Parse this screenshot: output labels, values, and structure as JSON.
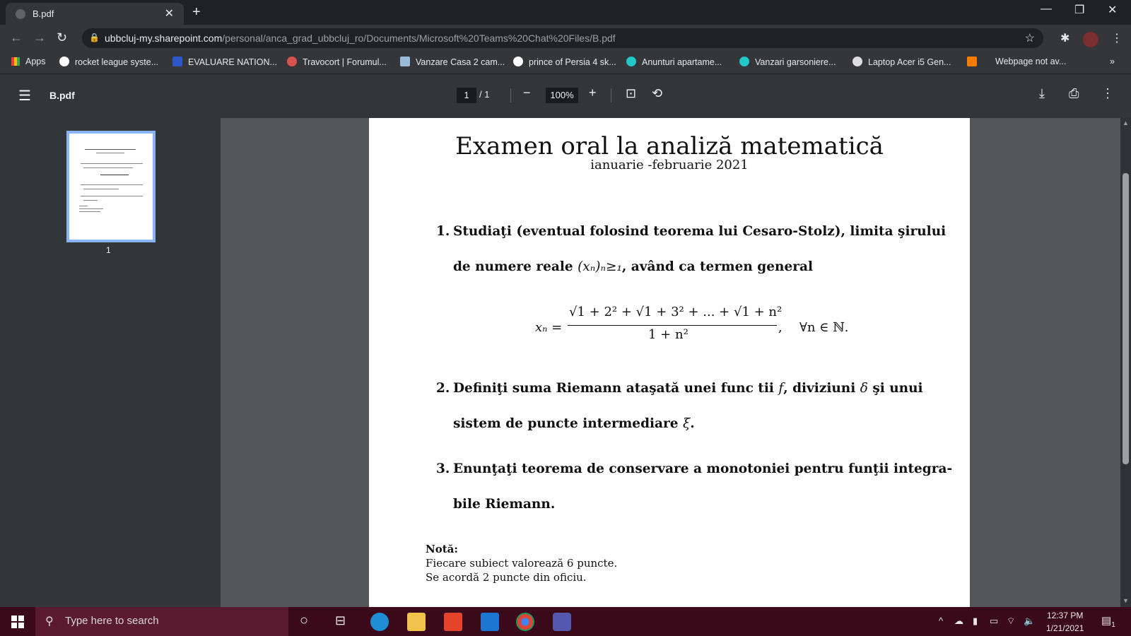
{
  "browser": {
    "tab_title": "B.pdf",
    "url_host": "ubbcluj-my.sharepoint.com",
    "url_path": "/personal/anca_grad_ubbcluj_ro/Documents/Microsoft%20Teams%20Chat%20Files/B.pdf"
  },
  "bookmarks": [
    "Apps",
    "rocket league syste...",
    "EVALUARE NATION...",
    "Travocort | Forumul...",
    "Vanzare Casa 2 cam...",
    "prince of Persia 4 sk...",
    "Anunturi apartame...",
    "Vanzari garsoniere...",
    "Laptop Acer i5 Gen...",
    "Webpage not av..."
  ],
  "pdf_toolbar": {
    "file_name": "B.pdf",
    "page_current": "1",
    "page_total": "1",
    "zoom": "100%"
  },
  "sidebar": {
    "thumb_label": "1"
  },
  "document": {
    "title": "Examen oral la analiză matematică",
    "subtitle": "ianuarie -februarie 2021",
    "q1_num": "1.",
    "q1_line1": "Studiaţi (eventual folosind teorema lui Cesaro-Stolz), limita şirului",
    "q1_line2_a": "de numere reale ",
    "q1_line2_math": "(xₙ)ₙ≥₁",
    "q1_line2_b": ", având ca termen general",
    "formula_lhs": "xₙ =",
    "formula_num": "√1 + 2² + √1 + 3² + ... + √1 + n²",
    "formula_den": "1 + n²",
    "formula_comma": ",",
    "formula_forall": "∀n ∈ ℕ.",
    "q2_num": "2.",
    "q2_line1_a": "Definiţi suma Riemann ataşată unei func tii ",
    "q2_f": "f",
    "q2_line1_b": ", diviziuni ",
    "q2_delta": "δ",
    "q2_line1_c": " şi unui",
    "q2_line2_a": "sistem de puncte intermediare ",
    "q2_xi": "ξ",
    "q2_line2_b": ".",
    "q3_num": "3.",
    "q3_line1": "Enunţaţi teorema de conservare a monotoniei pentru funţii integra-",
    "q3_line2": "bile Riemann.",
    "note_head": "Notă:",
    "note_line1": "Fiecare subiect valorează 6 puncte.",
    "note_line2": "Se acordă 2 puncte din oficiu."
  },
  "taskbar": {
    "search_placeholder": "Type here to search",
    "time": "12:37 PM",
    "date": "1/21/2021",
    "notification_count": "1"
  }
}
